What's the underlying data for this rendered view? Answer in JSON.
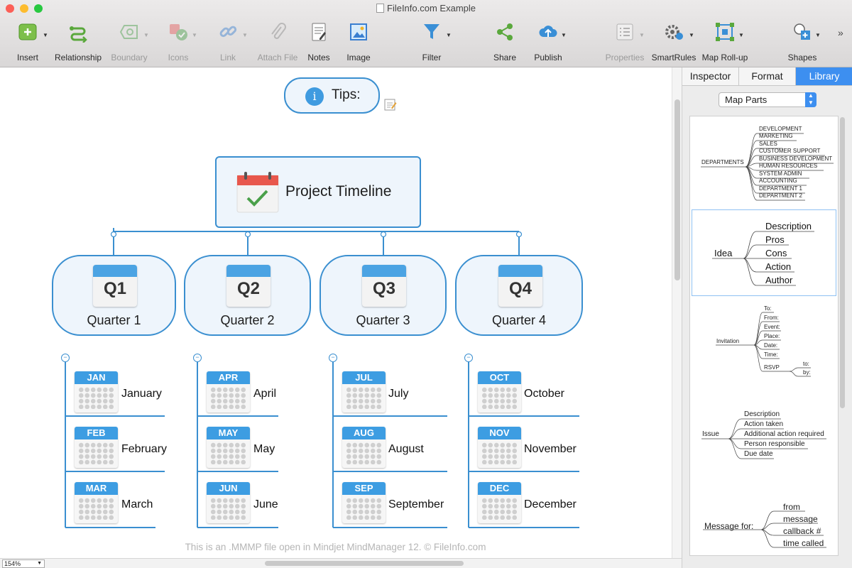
{
  "window": {
    "title": "FileInfo.com Example"
  },
  "toolbar": {
    "insert": "Insert",
    "relationship": "Relationship",
    "boundary": "Boundary",
    "icons": "Icons",
    "link": "Link",
    "attach_file": "Attach File",
    "notes": "Notes",
    "image": "Image",
    "filter": "Filter",
    "share": "Share",
    "publish": "Publish",
    "properties": "Properties",
    "smartrules": "SmartRules",
    "map_rollup": "Map Roll-up",
    "shapes": "Shapes",
    "overflow": "»"
  },
  "map": {
    "tips": {
      "icon": "i",
      "label": "Tips:"
    },
    "central": {
      "label": "Project Timeline"
    },
    "quarters": [
      {
        "badge": "Q1",
        "label": "Quarter 1",
        "collapse": "−",
        "months": [
          {
            "abbr": "JAN",
            "name": "January"
          },
          {
            "abbr": "FEB",
            "name": "February"
          },
          {
            "abbr": "MAR",
            "name": "March"
          }
        ]
      },
      {
        "badge": "Q2",
        "label": "Quarter 2",
        "collapse": "−",
        "months": [
          {
            "abbr": "APR",
            "name": "April"
          },
          {
            "abbr": "MAY",
            "name": "May"
          },
          {
            "abbr": "JUN",
            "name": "June"
          }
        ]
      },
      {
        "badge": "Q3",
        "label": "Quarter 3",
        "collapse": "−",
        "months": [
          {
            "abbr": "JUL",
            "name": "July"
          },
          {
            "abbr": "AUG",
            "name": "August"
          },
          {
            "abbr": "SEP",
            "name": "September"
          }
        ]
      },
      {
        "badge": "Q4",
        "label": "Quarter 4",
        "collapse": "−",
        "months": [
          {
            "abbr": "OCT",
            "name": "October"
          },
          {
            "abbr": "NOV",
            "name": "November"
          },
          {
            "abbr": "DEC",
            "name": "December"
          }
        ]
      }
    ],
    "footer": "This is an .MMMP file open in Mindjet MindManager 12. © FileInfo.com"
  },
  "status": {
    "zoom": "154%"
  },
  "panel": {
    "tabs": [
      "Inspector",
      "Format",
      "Library"
    ],
    "active_tab": "Library",
    "dropdown": "Map Parts",
    "library": {
      "departments": {
        "root": "DEPARTMENTS",
        "children": [
          "DEVELOPMENT",
          "MARKETING",
          "SALES",
          "CUSTOMER SUPPORT",
          "BUSINESS DEVELOPMENT",
          "HUMAN RESOURCES",
          "SYSTEM ADMIN",
          "ACCOUNTING",
          "DEPARTMENT 1",
          "DEPARTMENT 2"
        ]
      },
      "idea": {
        "root": "Idea",
        "children": [
          "Description",
          "Pros",
          "Cons",
          "Action",
          "Author"
        ]
      },
      "invitation": {
        "root": "Invitation",
        "children": [
          "To:",
          "From:",
          "Event:",
          "Place:",
          "Date:",
          "Time:",
          "RSVP"
        ],
        "rsvp_children": [
          "to:",
          "by:"
        ]
      },
      "issue": {
        "root": "Issue",
        "children": [
          "Description",
          "Action taken",
          "Additional action required",
          "Person responsible",
          "Due date"
        ]
      },
      "message": {
        "root": "Message for:",
        "children": [
          "from",
          "message",
          "callback #",
          "time called"
        ]
      }
    }
  },
  "colors": {
    "accent": "#3a8fd0",
    "tab_active": "#3d8ff0",
    "node_fill": "#eef5fc",
    "calendar_header": "#3d9de2"
  }
}
